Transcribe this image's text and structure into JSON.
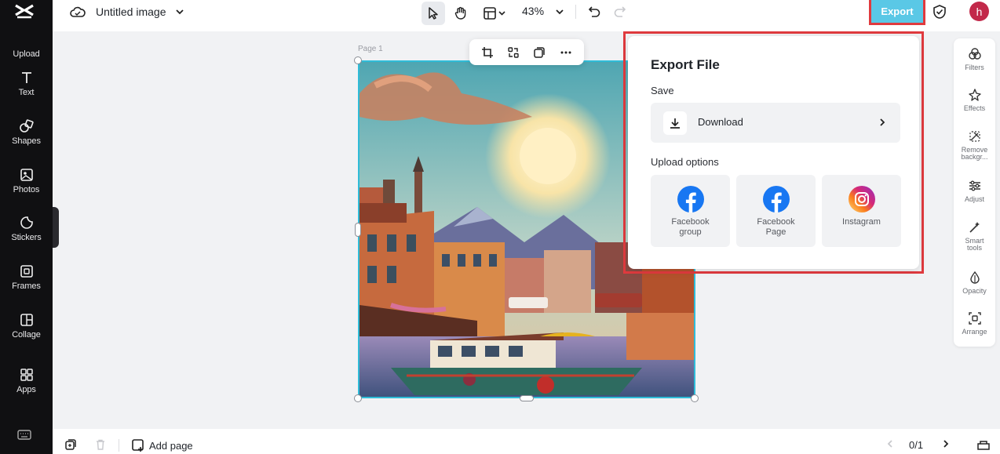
{
  "topbar": {
    "doc_title": "Untitled image",
    "zoom": "43%",
    "export_label": "Export",
    "avatar_initial": "h"
  },
  "sidebar": {
    "items": [
      {
        "label": "Upload",
        "icon": "upload-icon"
      },
      {
        "label": "Text",
        "icon": "text-icon"
      },
      {
        "label": "Shapes",
        "icon": "shapes-icon"
      },
      {
        "label": "Photos",
        "icon": "photos-icon"
      },
      {
        "label": "Stickers",
        "icon": "stickers-icon"
      },
      {
        "label": "Frames",
        "icon": "frames-icon"
      },
      {
        "label": "Collage",
        "icon": "collage-icon"
      },
      {
        "label": "Apps",
        "icon": "apps-icon"
      }
    ]
  },
  "canvas": {
    "page_label": "Page 1"
  },
  "right_panel": {
    "items": [
      {
        "label": "Filters",
        "icon": "filters-icon"
      },
      {
        "label": "Effects",
        "icon": "effects-icon"
      },
      {
        "label": "Remove",
        "label2": "backgr...",
        "icon": "remove-background-icon"
      },
      {
        "label": "Adjust",
        "icon": "adjust-icon"
      },
      {
        "label": "Smart",
        "label2": "tools",
        "icon": "smart-tools-icon"
      },
      {
        "label": "Opacity",
        "icon": "opacity-icon"
      },
      {
        "label": "Arrange",
        "icon": "arrange-icon"
      }
    ]
  },
  "export_panel": {
    "title": "Export File",
    "save_heading": "Save",
    "download_label": "Download",
    "upload_heading": "Upload options",
    "options": [
      {
        "line1": "Facebook",
        "line2": "group",
        "icon": "facebook-icon"
      },
      {
        "line1": "Facebook",
        "line2": "Page",
        "icon": "facebook-icon"
      },
      {
        "line1": "Instagram",
        "line2": "",
        "icon": "instagram-icon"
      }
    ]
  },
  "bottombar": {
    "add_page_label": "Add page",
    "page_indicator": "0/1"
  },
  "colors": {
    "sidebar_bg": "#101012",
    "export_button": "#5ac8e6",
    "highlight_red": "#e03a3e",
    "selection_cyan": "#2fbcd8",
    "avatar": "#c2294a",
    "facebook_blue": "#1877f2"
  }
}
